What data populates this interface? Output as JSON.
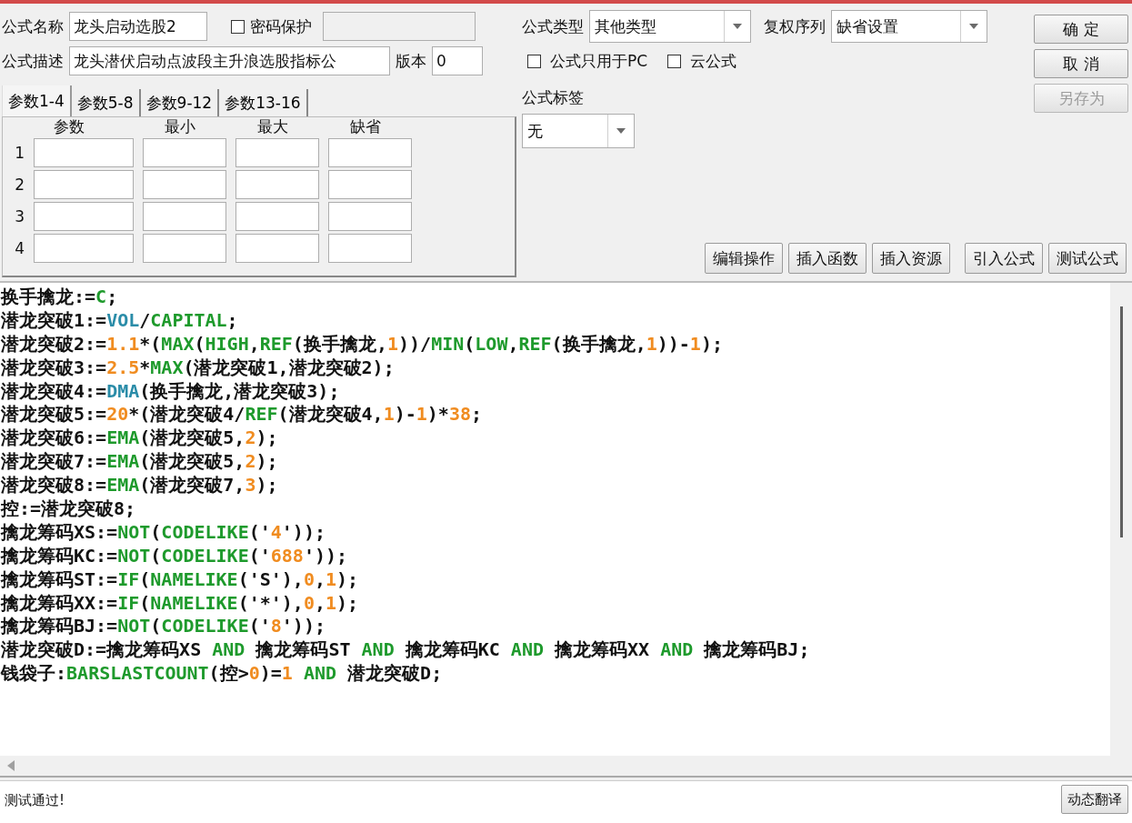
{
  "form": {
    "name_label": "公式名称",
    "name_value": "龙头启动选股2",
    "password": {
      "label": "密码保护",
      "checked": false
    },
    "description_label": "公式描述",
    "description_value": "龙头潜伏启动点波段主升浪选股指标公",
    "version_label": "版本",
    "version_value": "0"
  },
  "formula_type": {
    "label": "公式类型",
    "value": "其他类型"
  },
  "adjust_sequence": {
    "label": "复权序列",
    "value": "缺省设置"
  },
  "options": [
    {
      "label": "公式只用于PC",
      "checked": false
    },
    {
      "label": "云公式",
      "checked": false
    }
  ],
  "formula_tag": {
    "label": "公式标签",
    "value": "无"
  },
  "side_buttons": [
    {
      "label": "确 定",
      "disabled": false
    },
    {
      "label": "取 消",
      "disabled": false
    },
    {
      "label": "另存为",
      "disabled": true
    }
  ],
  "param_tabs": [
    {
      "label": "参数1-4",
      "selected": true
    },
    {
      "label": "参数5-8",
      "selected": false
    },
    {
      "label": "参数9-12",
      "selected": false
    },
    {
      "label": "参数13-16",
      "selected": false
    }
  ],
  "param_columns": [
    "参数",
    "最小",
    "最大",
    "缺省"
  ],
  "param_rows": [
    "1",
    "2",
    "3",
    "4"
  ],
  "toolbar_buttons": [
    "编辑操作",
    "插入函数",
    "插入资源",
    "引入公式",
    "测试公式"
  ],
  "code_lines": [
    [
      {
        "kind": "text",
        "text": "换手擒龙:="
      },
      {
        "kind": "function",
        "text": "C"
      },
      {
        "kind": "text",
        "text": ";"
      }
    ],
    [
      {
        "kind": "text",
        "text": "潜龙突破1:="
      },
      {
        "kind": "variable",
        "text": "VOL"
      },
      {
        "kind": "text",
        "text": "/"
      },
      {
        "kind": "function",
        "text": "CAPITAL"
      },
      {
        "kind": "text",
        "text": ";"
      }
    ],
    [
      {
        "kind": "text",
        "text": "潜龙突破2:="
      },
      {
        "kind": "number",
        "text": "1.1"
      },
      {
        "kind": "text",
        "text": "*("
      },
      {
        "kind": "function",
        "text": "MAX"
      },
      {
        "kind": "text",
        "text": "("
      },
      {
        "kind": "function",
        "text": "HIGH"
      },
      {
        "kind": "text",
        "text": ","
      },
      {
        "kind": "function",
        "text": "REF"
      },
      {
        "kind": "text",
        "text": "(换手擒龙,"
      },
      {
        "kind": "number",
        "text": "1"
      },
      {
        "kind": "text",
        "text": "))/"
      },
      {
        "kind": "function",
        "text": "MIN"
      },
      {
        "kind": "text",
        "text": "("
      },
      {
        "kind": "function",
        "text": "LOW"
      },
      {
        "kind": "text",
        "text": ","
      },
      {
        "kind": "function",
        "text": "REF"
      },
      {
        "kind": "text",
        "text": "(换手擒龙,"
      },
      {
        "kind": "number",
        "text": "1"
      },
      {
        "kind": "text",
        "text": "))-"
      },
      {
        "kind": "number",
        "text": "1"
      },
      {
        "kind": "text",
        "text": ");"
      }
    ],
    [
      {
        "kind": "text",
        "text": "潜龙突破3:="
      },
      {
        "kind": "number",
        "text": "2.5"
      },
      {
        "kind": "text",
        "text": "*"
      },
      {
        "kind": "function",
        "text": "MAX"
      },
      {
        "kind": "text",
        "text": "(潜龙突破1,潜龙突破2);"
      }
    ],
    [
      {
        "kind": "text",
        "text": "潜龙突破4:="
      },
      {
        "kind": "variable",
        "text": "DMA"
      },
      {
        "kind": "text",
        "text": "(换手擒龙,潜龙突破3);"
      }
    ],
    [
      {
        "kind": "text",
        "text": "潜龙突破5:="
      },
      {
        "kind": "number",
        "text": "20"
      },
      {
        "kind": "text",
        "text": "*(潜龙突破4/"
      },
      {
        "kind": "function",
        "text": "REF"
      },
      {
        "kind": "text",
        "text": "(潜龙突破4,"
      },
      {
        "kind": "number",
        "text": "1"
      },
      {
        "kind": "text",
        "text": ")-"
      },
      {
        "kind": "number",
        "text": "1"
      },
      {
        "kind": "text",
        "text": ")*"
      },
      {
        "kind": "number",
        "text": "38"
      },
      {
        "kind": "text",
        "text": ";"
      }
    ],
    [
      {
        "kind": "text",
        "text": "潜龙突破6:="
      },
      {
        "kind": "function",
        "text": "EMA"
      },
      {
        "kind": "text",
        "text": "(潜龙突破5,"
      },
      {
        "kind": "number",
        "text": "2"
      },
      {
        "kind": "text",
        "text": ");"
      }
    ],
    [
      {
        "kind": "text",
        "text": "潜龙突破7:="
      },
      {
        "kind": "function",
        "text": "EMA"
      },
      {
        "kind": "text",
        "text": "(潜龙突破5,"
      },
      {
        "kind": "number",
        "text": "2"
      },
      {
        "kind": "text",
        "text": ");"
      }
    ],
    [
      {
        "kind": "text",
        "text": "潜龙突破8:="
      },
      {
        "kind": "function",
        "text": "EMA"
      },
      {
        "kind": "text",
        "text": "(潜龙突破7,"
      },
      {
        "kind": "number",
        "text": "3"
      },
      {
        "kind": "text",
        "text": ");"
      }
    ],
    [
      {
        "kind": "text",
        "text": "控:=潜龙突破8;"
      }
    ],
    [
      {
        "kind": "text",
        "text": "擒龙筹码XS:="
      },
      {
        "kind": "function",
        "text": "NOT"
      },
      {
        "kind": "text",
        "text": "("
      },
      {
        "kind": "function",
        "text": "CODELIKE"
      },
      {
        "kind": "text",
        "text": "('"
      },
      {
        "kind": "number",
        "text": "4"
      },
      {
        "kind": "text",
        "text": "'));"
      }
    ],
    [
      {
        "kind": "text",
        "text": "擒龙筹码KC:="
      },
      {
        "kind": "function",
        "text": "NOT"
      },
      {
        "kind": "text",
        "text": "("
      },
      {
        "kind": "function",
        "text": "CODELIKE"
      },
      {
        "kind": "text",
        "text": "('"
      },
      {
        "kind": "number",
        "text": "688"
      },
      {
        "kind": "text",
        "text": "'));"
      }
    ],
    [
      {
        "kind": "text",
        "text": "擒龙筹码ST:="
      },
      {
        "kind": "function",
        "text": "IF"
      },
      {
        "kind": "text",
        "text": "("
      },
      {
        "kind": "function",
        "text": "NAMELIKE"
      },
      {
        "kind": "text",
        "text": "('S'),"
      },
      {
        "kind": "number",
        "text": "0"
      },
      {
        "kind": "text",
        "text": ","
      },
      {
        "kind": "number",
        "text": "1"
      },
      {
        "kind": "text",
        "text": ");"
      }
    ],
    [
      {
        "kind": "text",
        "text": "擒龙筹码XX:="
      },
      {
        "kind": "function",
        "text": "IF"
      },
      {
        "kind": "text",
        "text": "("
      },
      {
        "kind": "function",
        "text": "NAMELIKE"
      },
      {
        "kind": "text",
        "text": "('*'),"
      },
      {
        "kind": "number",
        "text": "0"
      },
      {
        "kind": "text",
        "text": ","
      },
      {
        "kind": "number",
        "text": "1"
      },
      {
        "kind": "text",
        "text": ");"
      }
    ],
    [
      {
        "kind": "text",
        "text": "擒龙筹码BJ:="
      },
      {
        "kind": "function",
        "text": "NOT"
      },
      {
        "kind": "text",
        "text": "("
      },
      {
        "kind": "function",
        "text": "CODELIKE"
      },
      {
        "kind": "text",
        "text": "('"
      },
      {
        "kind": "number",
        "text": "8"
      },
      {
        "kind": "text",
        "text": "'));"
      }
    ],
    [
      {
        "kind": "text",
        "text": "潜龙突破D:=擒龙筹码XS "
      },
      {
        "kind": "function",
        "text": "AND"
      },
      {
        "kind": "text",
        "text": " 擒龙筹码ST "
      },
      {
        "kind": "function",
        "text": "AND"
      },
      {
        "kind": "text",
        "text": " 擒龙筹码KC "
      },
      {
        "kind": "function",
        "text": "AND"
      },
      {
        "kind": "text",
        "text": " 擒龙筹码XX "
      },
      {
        "kind": "function",
        "text": "AND"
      },
      {
        "kind": "text",
        "text": " 擒龙筹码BJ;"
      }
    ],
    [
      {
        "kind": "text",
        "text": "钱袋子:"
      },
      {
        "kind": "function",
        "text": "BARSLASTCOUNT"
      },
      {
        "kind": "text",
        "text": "(控>"
      },
      {
        "kind": "number",
        "text": "0"
      },
      {
        "kind": "text",
        "text": ")="
      },
      {
        "kind": "number",
        "text": "1"
      },
      {
        "kind": "function",
        "text": " AND"
      },
      {
        "kind": "text",
        "text": " 潜龙突破D;"
      }
    ]
  ],
  "status": "测试通过!",
  "translate_button": "动态翻译"
}
